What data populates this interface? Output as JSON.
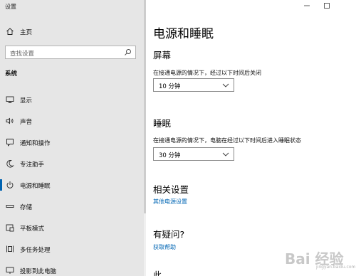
{
  "app": {
    "title": "设置"
  },
  "window_controls": {
    "minimize_icon": "minimize-icon",
    "maximize_icon": "maximize-icon"
  },
  "sidebar": {
    "home_label": "主页",
    "search_placeholder": "查找设置",
    "section_title": "系统",
    "items": [
      {
        "label": "显示",
        "icon": "monitor-icon"
      },
      {
        "label": "声音",
        "icon": "speaker-icon"
      },
      {
        "label": "通知和操作",
        "icon": "notification-icon"
      },
      {
        "label": "专注助手",
        "icon": "moon-icon"
      },
      {
        "label": "电源和睡眠",
        "icon": "power-icon",
        "selected": true
      },
      {
        "label": "存储",
        "icon": "storage-icon"
      },
      {
        "label": "平板模式",
        "icon": "tablet-icon"
      },
      {
        "label": "多任务处理",
        "icon": "multitask-icon"
      },
      {
        "label": "投影到此电脑",
        "icon": "projector-icon"
      }
    ]
  },
  "main": {
    "title": "电源和睡眠",
    "screen": {
      "heading": "屏幕",
      "description": "在接通电源的情况下，经过以下时间后关闭",
      "value": "10 分钟"
    },
    "sleep": {
      "heading": "睡眠",
      "description": "在接通电源的情况下，电脑在经过以下时间后进入睡眠状态",
      "value": "30 分钟"
    },
    "related": {
      "heading": "相关设置",
      "link": "其他电源设置"
    },
    "question": {
      "heading": "有疑问?",
      "link": "获取帮助"
    },
    "cutoff_heading": "此"
  },
  "watermark": {
    "text": "Bai 经验",
    "sub": "jingyan.baidu.com"
  },
  "colors": {
    "accent": "#0063b1",
    "link": "#0066b4",
    "sidebar_bg": "#e6e6e6"
  }
}
